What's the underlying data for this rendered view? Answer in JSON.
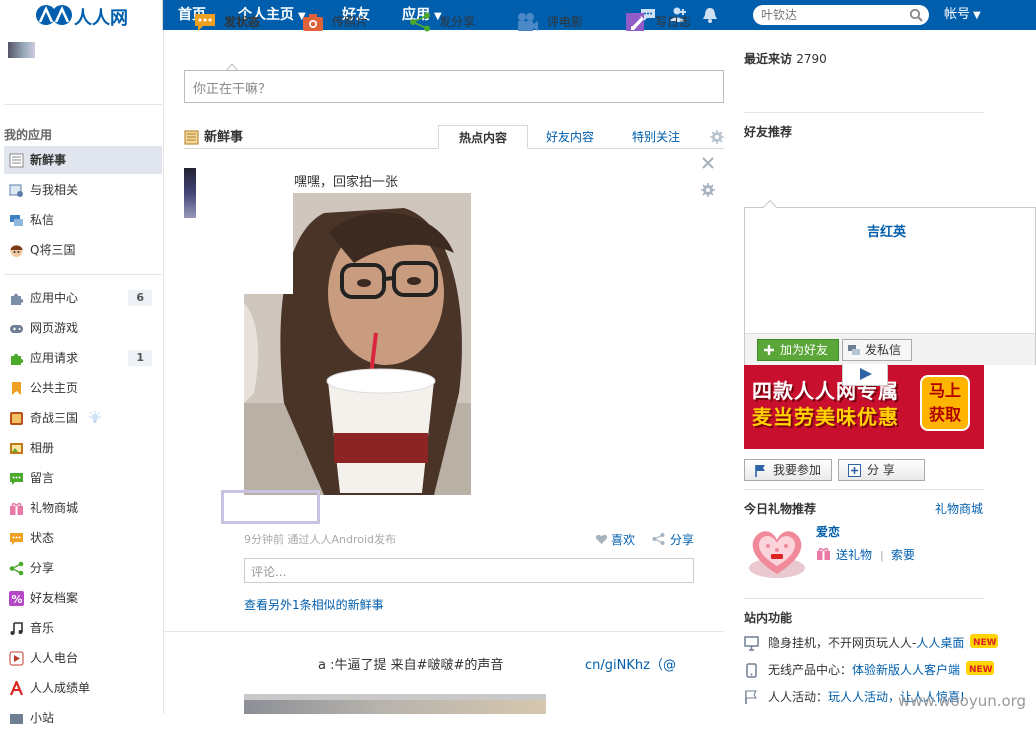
{
  "brand": {
    "name": "人人网"
  },
  "nav": {
    "items": [
      {
        "label": "首页"
      },
      {
        "label": "个人主页"
      },
      {
        "label": "好友"
      },
      {
        "label": "应用"
      }
    ],
    "search_placeholder": "叶钦达",
    "account": "帐号"
  },
  "sidebar": {
    "section_title": "我的应用",
    "group1": [
      {
        "label": "新鲜事",
        "icon": "newsfeed-icon",
        "active": true
      },
      {
        "label": "与我相关",
        "icon": "related-icon"
      },
      {
        "label": "私信",
        "icon": "message-icon"
      },
      {
        "label": "Q将三国",
        "icon": "game-avatar-icon"
      }
    ],
    "group2": [
      {
        "label": "应用中心",
        "icon": "puzzle-icon",
        "count": "6"
      },
      {
        "label": "网页游戏",
        "icon": "gamepad-icon"
      },
      {
        "label": "应用请求",
        "icon": "green-puzzle-icon",
        "count": "1"
      },
      {
        "label": "公共主页",
        "icon": "bookmark-icon"
      },
      {
        "label": "奇战三国",
        "icon": "card-game-icon"
      },
      {
        "label": "相册",
        "icon": "album-icon"
      },
      {
        "label": "留言",
        "icon": "comment-icon"
      },
      {
        "label": "礼物商城",
        "icon": "gift-icon"
      },
      {
        "label": "状态",
        "icon": "status-icon"
      },
      {
        "label": "分享",
        "icon": "share-icon"
      },
      {
        "label": "好友档案",
        "icon": "percent-icon"
      },
      {
        "label": "音乐",
        "icon": "music-icon"
      },
      {
        "label": "人人电台",
        "icon": "radio-icon"
      },
      {
        "label": "人人成绩单",
        "icon": "report-icon"
      },
      {
        "label": "小站",
        "icon": "site-icon"
      }
    ]
  },
  "publisher": {
    "tabs": [
      {
        "label": "发状态"
      },
      {
        "label": "传照片"
      },
      {
        "label": "发分享"
      },
      {
        "label": "评电影"
      },
      {
        "label": "写日志"
      }
    ],
    "placeholder": "你正在干嘛？"
  },
  "feed": {
    "title": "新鲜事",
    "tabs": [
      {
        "label": "热点内容",
        "active": true
      },
      {
        "label": "好友内容"
      },
      {
        "label": "特别关注"
      }
    ],
    "item1": {
      "status": "嘿嘿，回家拍一张",
      "meta": "9分钟前  通过人人Android发布",
      "like": "喜欢",
      "share": "分享",
      "comment_placeholder": "评论...",
      "more": "查看另外1条相似的新鲜事"
    },
    "item2": {
      "text": "a :牛逼了提 来自#啵啵#的声音",
      "link": "cn/giNKhz（@"
    }
  },
  "right": {
    "visits_label": "最近来访",
    "visits_count": "2790",
    "friend_title": "好友推荐",
    "friend_name": "吉红英",
    "add_friend": "加为好友",
    "send_message": "发私信",
    "ad_line1": "四款人人网专属",
    "ad_line2": "麦当劳美味优惠",
    "ad_btn1": "马上",
    "ad_btn2": "获取",
    "join": "我要参加",
    "share": "分 享",
    "gift_title": "今日礼物推荐",
    "gift_shop": "礼物商城",
    "gift_name": "爱恋",
    "gift_send": "送礼物",
    "gift_sep": "|",
    "gift_ask": "索要",
    "functions_title": "站内功能",
    "functions": [
      {
        "prefix": "隐身挂机，不开网页玩人人-",
        "link": "人人桌面",
        "new": true
      },
      {
        "prefix": "无线产品中心：",
        "link": "体验新版人人客户端",
        "new": true
      },
      {
        "prefix": "人人活动：",
        "link": "玩人人活动，让人人惊喜!",
        "new": false
      }
    ],
    "new_badge": "NEW"
  },
  "watermark": "www.wooyun.org",
  "colors": {
    "brand_blue": "#005eac",
    "accent_green": "#5aa638",
    "ad_red": "#c8102e"
  }
}
